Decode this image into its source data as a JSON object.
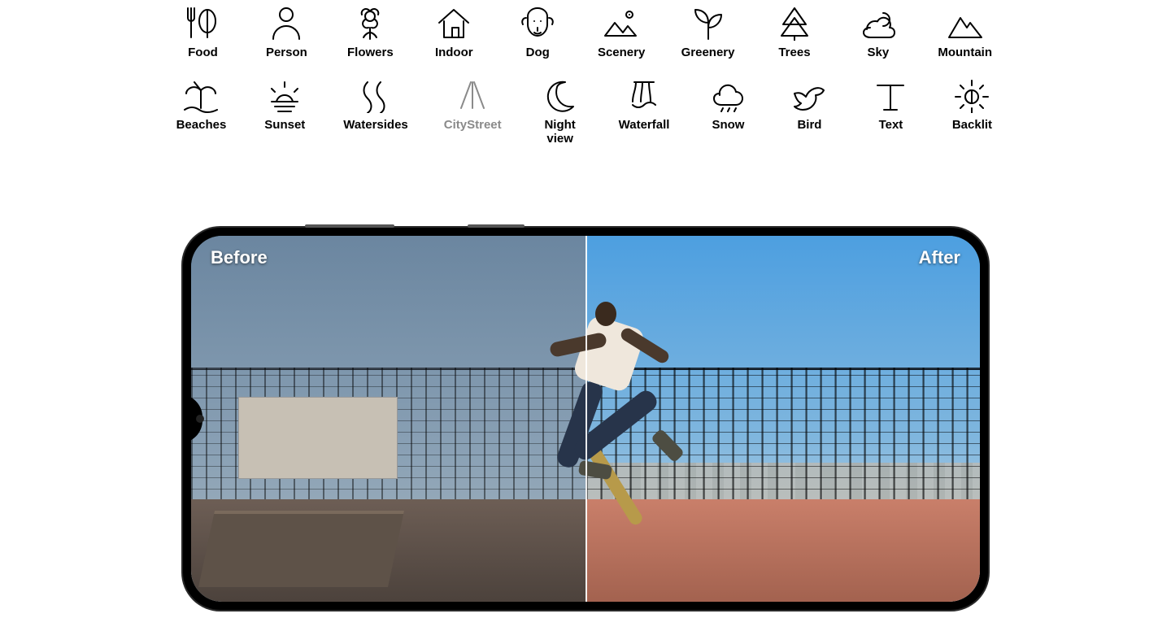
{
  "scene_categories_row1": [
    {
      "key": "food",
      "label": "Food",
      "icon": "food-icon"
    },
    {
      "key": "person",
      "label": "Person",
      "icon": "person-icon"
    },
    {
      "key": "flowers",
      "label": "Flowers",
      "icon": "flowers-icon"
    },
    {
      "key": "indoor",
      "label": "Indoor",
      "icon": "indoor-icon"
    },
    {
      "key": "dog",
      "label": "Dog",
      "icon": "dog-icon"
    },
    {
      "key": "scenery",
      "label": "Scenery",
      "icon": "scenery-icon"
    },
    {
      "key": "greenery",
      "label": "Greenery",
      "icon": "greenery-icon"
    },
    {
      "key": "trees",
      "label": "Trees",
      "icon": "trees-icon"
    },
    {
      "key": "sky",
      "label": "Sky",
      "icon": "sky-icon"
    },
    {
      "key": "mountain",
      "label": "Mountain",
      "icon": "mountain-icon"
    }
  ],
  "scene_categories_row2": [
    {
      "key": "beaches",
      "label": "Beaches",
      "icon": "beaches-icon"
    },
    {
      "key": "sunset",
      "label": "Sunset",
      "icon": "sunset-icon"
    },
    {
      "key": "watersides",
      "label": "Watersides",
      "icon": "watersides-icon"
    },
    {
      "key": "citystreet",
      "label": "CityStreet",
      "icon": "citystreet-icon",
      "dim": true
    },
    {
      "key": "nightview",
      "label": "Night view",
      "icon": "nightview-icon"
    },
    {
      "key": "waterfall",
      "label": "Waterfall",
      "icon": "waterfall-icon"
    },
    {
      "key": "snow",
      "label": "Snow",
      "icon": "snow-icon"
    },
    {
      "key": "bird",
      "label": "Bird",
      "icon": "bird-icon"
    },
    {
      "key": "text",
      "label": "Text",
      "icon": "text-icon"
    },
    {
      "key": "backlit",
      "label": "Backlit",
      "icon": "backlit-icon"
    }
  ],
  "comparison": {
    "before_label": "Before",
    "after_label": "After"
  }
}
